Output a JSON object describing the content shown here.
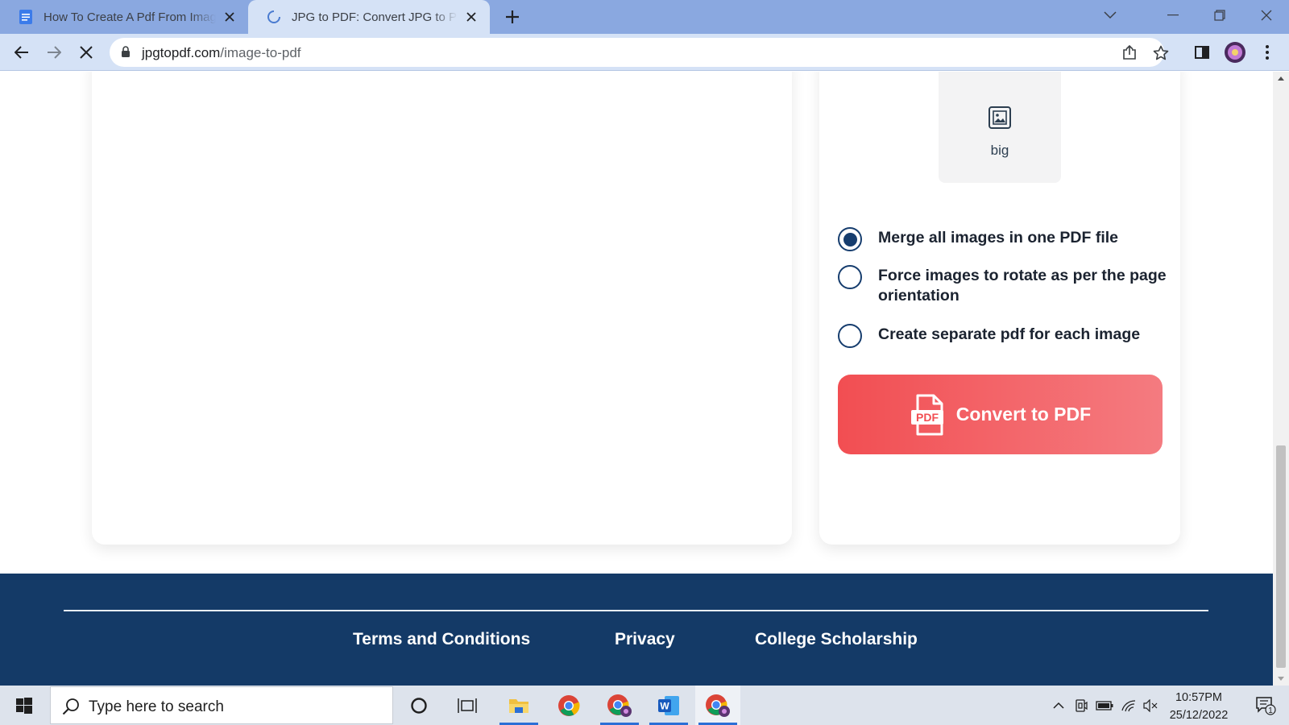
{
  "browser": {
    "tabs": [
      {
        "title": "How To Create A Pdf From Image",
        "favicon": "docs-icon"
      },
      {
        "title": "JPG to PDF: Convert JPG to PDF Online",
        "favicon": "loading-spinner-icon"
      }
    ],
    "active_tab_index": 1,
    "address": {
      "host": "jpgtopdf.com",
      "path": "/image-to-pdf"
    }
  },
  "page": {
    "page_size": {
      "label": "big"
    },
    "options": [
      {
        "label": "Merge all images in one PDF file",
        "selected": true
      },
      {
        "label": "Force images to rotate as per the page orientation",
        "selected": false
      },
      {
        "label": "Create separate pdf for each image",
        "selected": false
      }
    ],
    "convert_button": {
      "label": "Convert to PDF",
      "icon_text": "PDF"
    },
    "footer": {
      "links": [
        "Terms and Conditions",
        "Privacy",
        "College Scholarship"
      ]
    }
  },
  "taskbar": {
    "search_placeholder": "Type here to search",
    "time": "10:57PM",
    "date": "25/12/2022",
    "notification_count": "1"
  },
  "colors": {
    "tabstrip": "#8aa8e0",
    "toolbar": "#d5e2f6",
    "footer": "#143a67",
    "radio": "#163d6e",
    "convert_start": "#f24e52",
    "convert_end": "#f47b80"
  }
}
